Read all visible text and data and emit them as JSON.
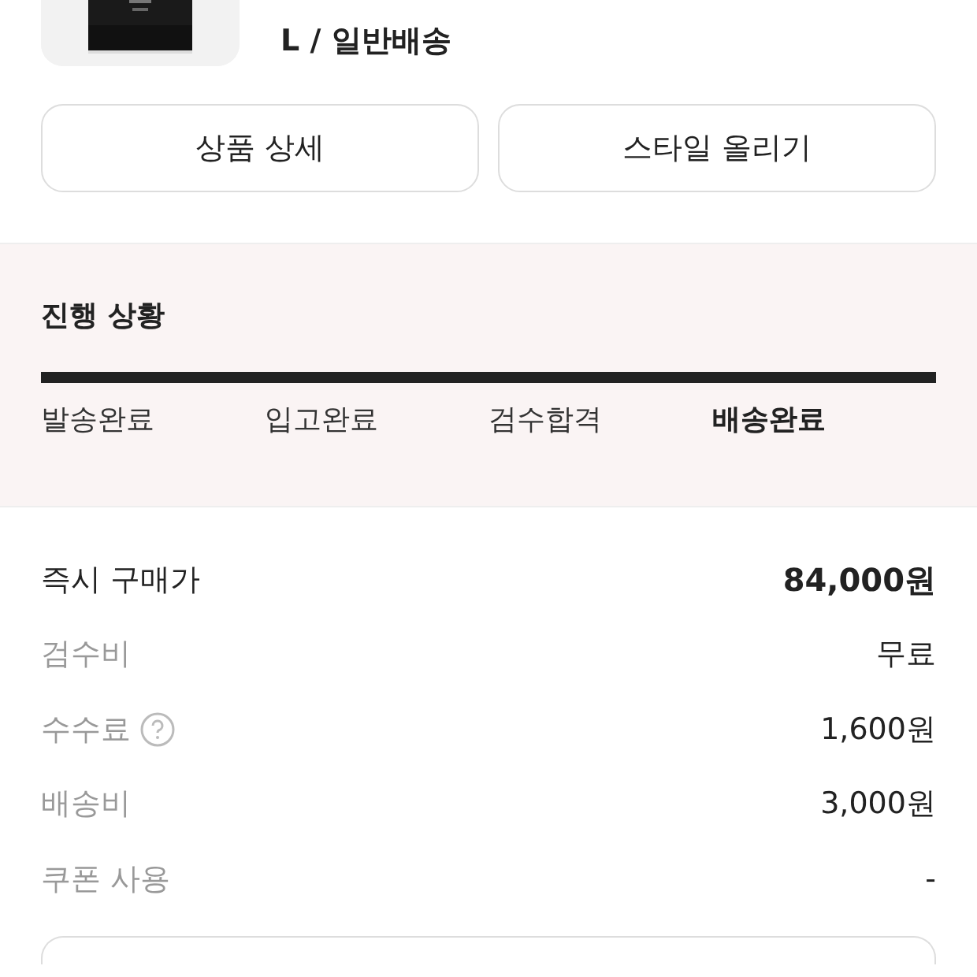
{
  "product": {
    "option": "L / 일반배송"
  },
  "buttons": [
    "상품 상세",
    "스타일 올리기"
  ],
  "progress": {
    "title": "진행 상황",
    "level": 1,
    "steps": [
      {
        "label": "발송완료",
        "selected": false
      },
      {
        "label": "입고완료",
        "selected": false
      },
      {
        "label": "검수합격",
        "selected": false
      },
      {
        "label": "배송완료",
        "selected": true
      }
    ]
  },
  "price_rows": [
    {
      "label": "즉시 구매가",
      "value": "84,000원",
      "emphasis": true,
      "help": false
    },
    {
      "label": "검수비",
      "value": "무료",
      "emphasis": false,
      "help": false
    },
    {
      "label": "수수료",
      "value": "1,600원",
      "emphasis": false,
      "help": true
    },
    {
      "label": "배송비",
      "value": "3,000원",
      "emphasis": false,
      "help": false
    },
    {
      "label": "쿠폰 사용",
      "value": "-",
      "emphasis": false,
      "help": false
    }
  ]
}
